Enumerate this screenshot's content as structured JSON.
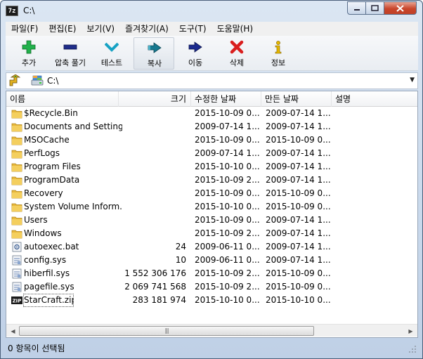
{
  "window": {
    "title": "C:\\",
    "app_icon_text": "7z"
  },
  "menu": [
    "파일(F)",
    "편집(E)",
    "보기(V)",
    "즐겨찾기(A)",
    "도구(T)",
    "도움말(H)"
  ],
  "toolbar": [
    {
      "label": "추가",
      "icon": "add-icon",
      "color": "#22b14c"
    },
    {
      "label": "압축 풀기",
      "icon": "extract-icon",
      "color": "#1f2d8a"
    },
    {
      "label": "테스트",
      "icon": "test-icon",
      "color": "#17a2c4"
    },
    {
      "label": "복사",
      "icon": "copy-icon",
      "color": "#16788f"
    },
    {
      "label": "이동",
      "icon": "move-icon",
      "color": "#1b2a8f"
    },
    {
      "label": "삭제",
      "icon": "delete-icon",
      "color": "#d91e1e"
    },
    {
      "label": "정보",
      "icon": "info-icon",
      "color": "#e5b800"
    }
  ],
  "address": {
    "path": "C:\\"
  },
  "columns": [
    "이름",
    "크기",
    "수정한 날짜",
    "만든 날짜",
    "설명"
  ],
  "rows": [
    {
      "type": "folder",
      "name": "$Recycle.Bin",
      "size": "",
      "modified": "2015-10-09 0...",
      "created": "2009-07-14 1..."
    },
    {
      "type": "folder",
      "name": "Documents and Settings",
      "size": "",
      "modified": "2009-07-14 1...",
      "created": "2009-07-14 1..."
    },
    {
      "type": "folder",
      "name": "MSOCache",
      "size": "",
      "modified": "2015-10-09 0...",
      "created": "2015-10-09 0..."
    },
    {
      "type": "folder",
      "name": "PerfLogs",
      "size": "",
      "modified": "2009-07-14 1...",
      "created": "2009-07-14 1..."
    },
    {
      "type": "folder",
      "name": "Program Files",
      "size": "",
      "modified": "2015-10-10 0...",
      "created": "2009-07-14 1..."
    },
    {
      "type": "folder",
      "name": "ProgramData",
      "size": "",
      "modified": "2015-10-09 2...",
      "created": "2009-07-14 1..."
    },
    {
      "type": "folder",
      "name": "Recovery",
      "size": "",
      "modified": "2015-10-09 0...",
      "created": "2015-10-09 0..."
    },
    {
      "type": "folder",
      "name": "System Volume Inform...",
      "size": "",
      "modified": "2015-10-10 0...",
      "created": "2015-10-09 0..."
    },
    {
      "type": "folder",
      "name": "Users",
      "size": "",
      "modified": "2015-10-09 0...",
      "created": "2009-07-14 1..."
    },
    {
      "type": "folder",
      "name": "Windows",
      "size": "",
      "modified": "2015-10-09 2...",
      "created": "2009-07-14 1..."
    },
    {
      "type": "bat",
      "name": "autoexec.bat",
      "size": "24",
      "modified": "2009-06-11 0...",
      "created": "2009-07-14 1..."
    },
    {
      "type": "sys",
      "name": "config.sys",
      "size": "10",
      "modified": "2009-06-11 0...",
      "created": "2009-07-14 1..."
    },
    {
      "type": "sys",
      "name": "hiberfil.sys",
      "size": "1 552 306 176",
      "modified": "2015-10-09 2...",
      "created": "2015-10-09 0..."
    },
    {
      "type": "sys",
      "name": "pagefile.sys",
      "size": "2 069 741 568",
      "modified": "2015-10-09 2...",
      "created": "2015-10-09 0..."
    },
    {
      "type": "zip",
      "name": "StarCraft.zip",
      "size": "283 181 974",
      "modified": "2015-10-10 0...",
      "created": "2015-10-10 0..."
    }
  ],
  "zip_icon_text": "ZIP",
  "status": {
    "text": "0 항목이 선택됨"
  }
}
